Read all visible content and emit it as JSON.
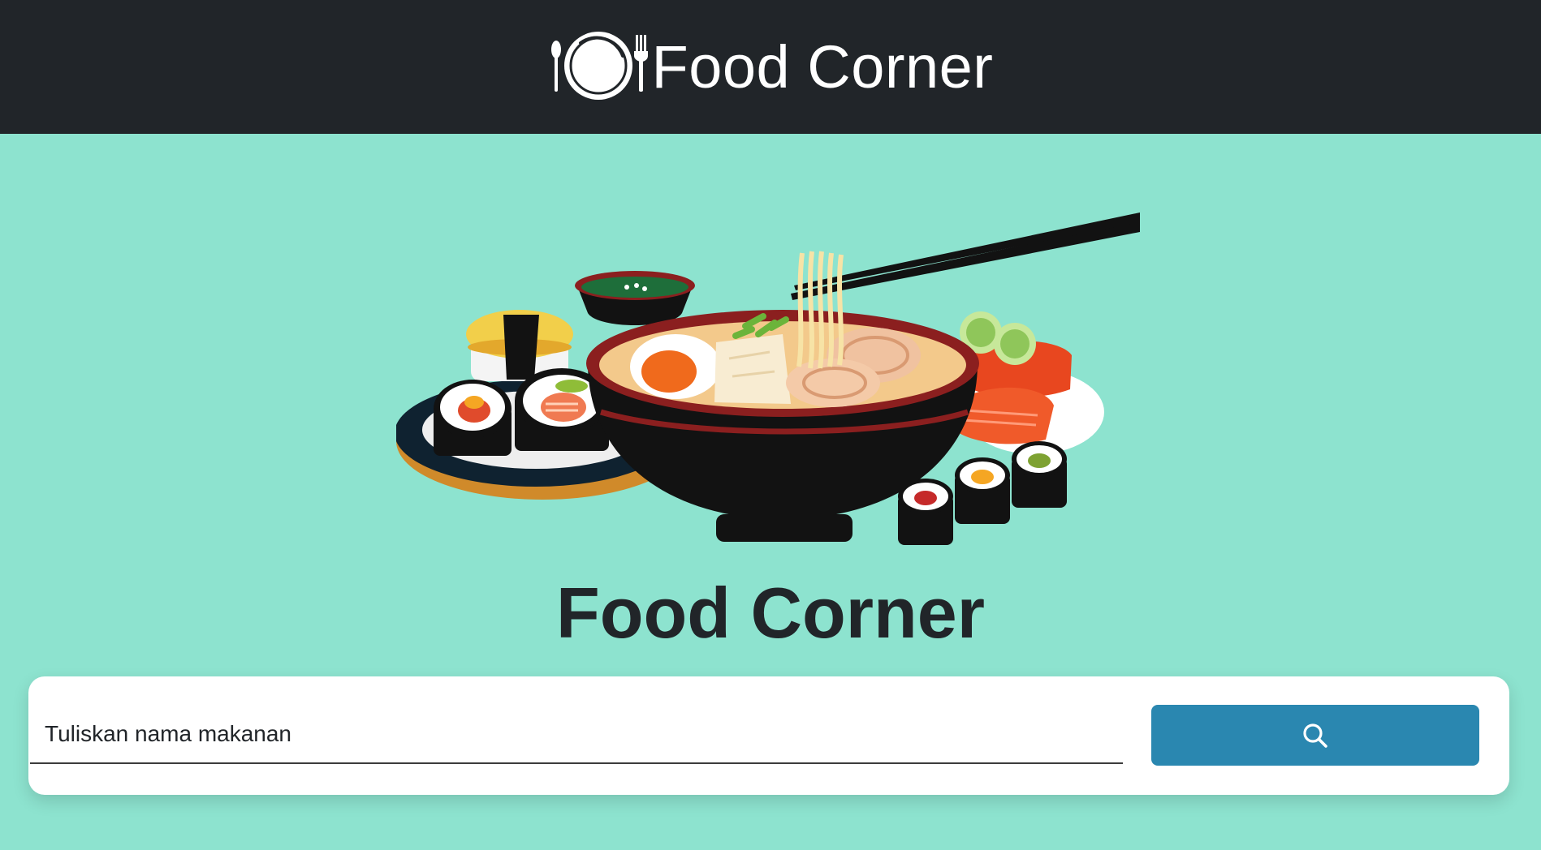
{
  "navbar": {
    "brand_text": "Food Corner",
    "logo_icon": "plate-fork-spoon-icon",
    "background": "#212529"
  },
  "hero": {
    "image_icon": "ramen-sushi-illustration",
    "title": "Food Corner"
  },
  "search": {
    "placeholder": "Tuliskan nama makanan",
    "value": "",
    "button_icon": "search-icon",
    "button_color": "#2a87b0"
  },
  "colors": {
    "page_background": "#8de3cf",
    "navbar": "#212529",
    "text_dark": "#212529",
    "accent": "#2a87b0"
  }
}
